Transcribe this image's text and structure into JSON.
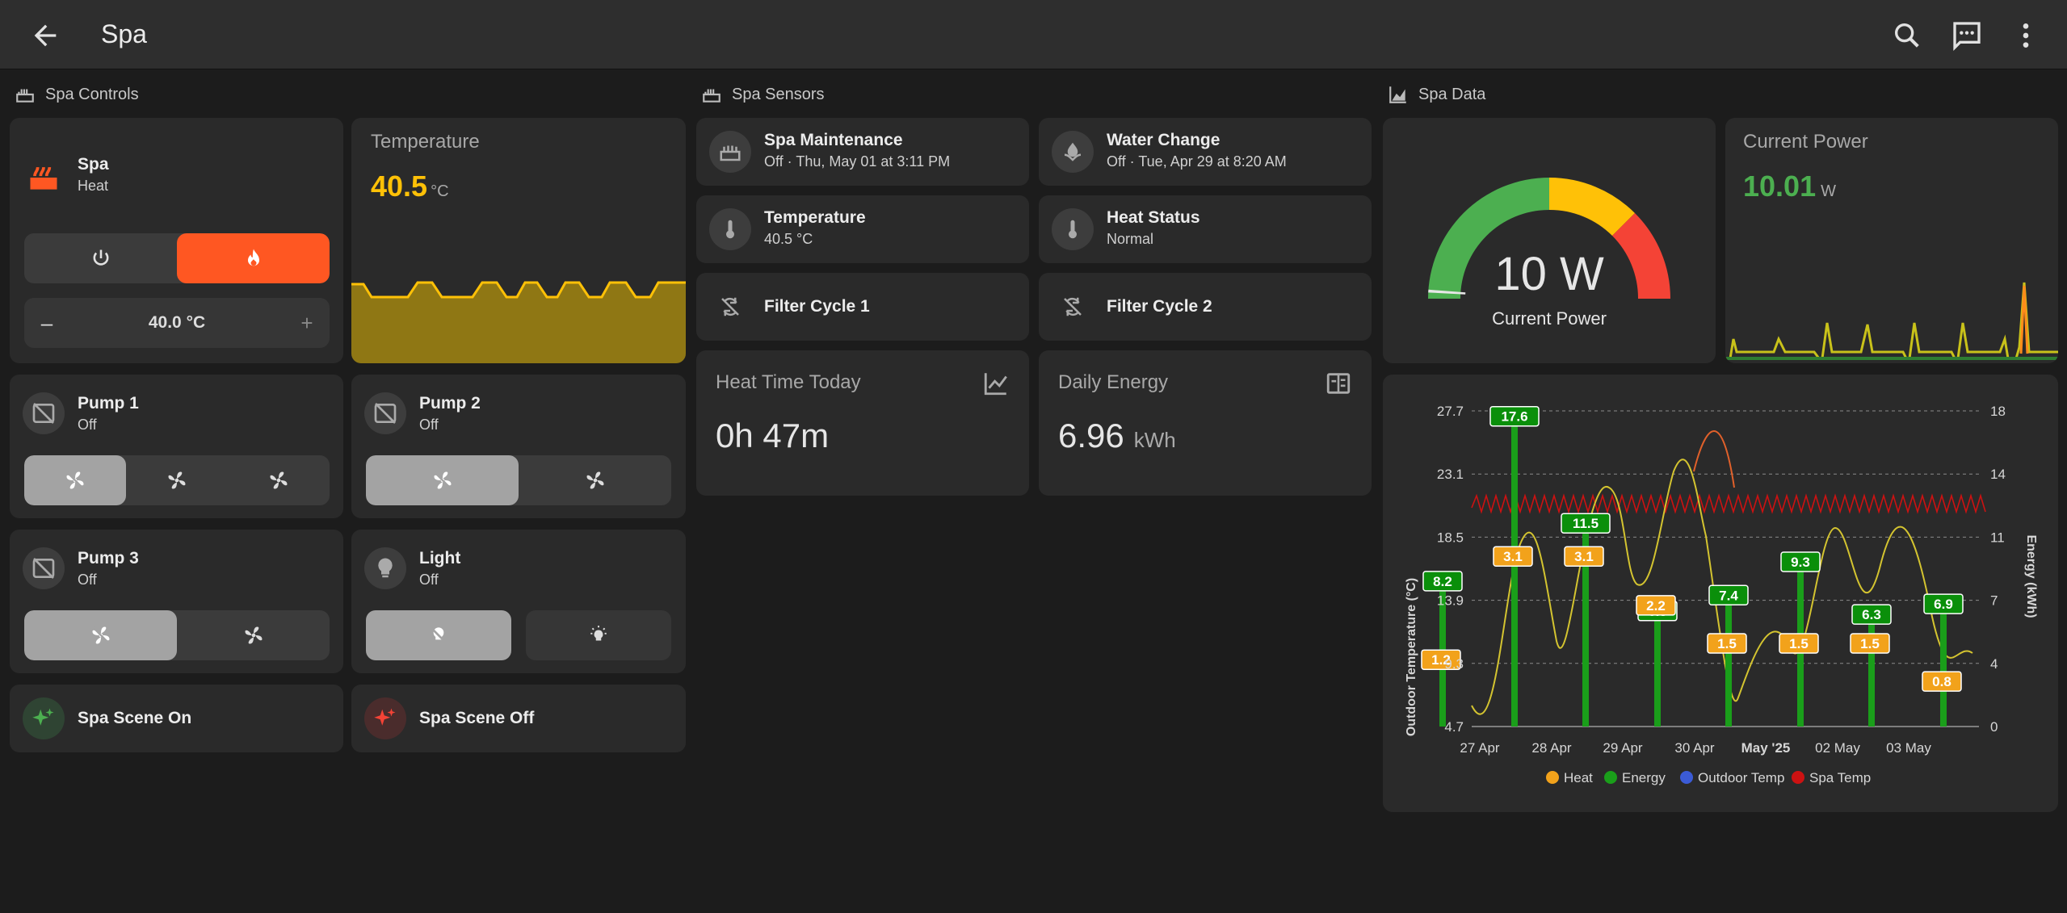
{
  "header": {
    "title": "Spa"
  },
  "sections": {
    "controls": "Spa Controls",
    "sensors": "Spa Sensors",
    "data": "Spa Data"
  },
  "colors": {
    "accent_orange": "#ff5722",
    "temp_yellow": "#ffc107",
    "gauge_green": "#4caf50",
    "gauge_yellow": "#ffc107",
    "gauge_red": "#f44336",
    "power_green": "#4caf50",
    "energy_green": "#1a9e1a",
    "heat_orange": "#f2a21b",
    "spatemp_red": "#cc1212",
    "outdoor_yellow": "#d4c430"
  },
  "spa": {
    "name": "Spa",
    "state": "Heat",
    "setpoint": "40.0 °C",
    "minus": "–",
    "plus": "+",
    "mode": "heat"
  },
  "temperature_tile": {
    "title": "Temperature",
    "value": "40.5",
    "unit": "°C"
  },
  "pumps": [
    {
      "name": "Pump 1",
      "state": "Off"
    },
    {
      "name": "Pump 2",
      "state": "Off"
    },
    {
      "name": "Pump 3",
      "state": "Off"
    }
  ],
  "light": {
    "name": "Light",
    "state": "Off"
  },
  "scenes": {
    "on": "Spa Scene On",
    "off": "Spa Scene Off"
  },
  "sensors": {
    "maintenance": {
      "name": "Spa Maintenance",
      "state": "Off · Thu, May 01 at 3:11 PM"
    },
    "water_change": {
      "name": "Water Change",
      "state": "Off · Tue, Apr 29 at 8:20 AM"
    },
    "temperature": {
      "name": "Temperature",
      "state": "40.5 °C"
    },
    "heat_status": {
      "name": "Heat Status",
      "state": "Normal"
    },
    "filter1": {
      "name": "Filter Cycle 1"
    },
    "filter2": {
      "name": "Filter Cycle 2"
    }
  },
  "heat_time": {
    "title": "Heat Time Today",
    "value": "0h 47m"
  },
  "daily_energy": {
    "title": "Daily Energy",
    "value": "6.96",
    "unit": "kWh"
  },
  "gauge": {
    "value": "10 W",
    "label": "Current Power",
    "fraction": 0.02
  },
  "current_power": {
    "title": "Current Power",
    "value": "10.01",
    "unit": "W"
  },
  "chart_data": {
    "type": "bar",
    "categories": [
      "27 Apr",
      "28 Apr",
      "29 Apr",
      "30 Apr",
      "May '25",
      "02 May",
      "03 May"
    ],
    "ylabel_left": "Outdoor Temperature (°C)",
    "ylabel_right": "Energy (kWh)",
    "yticks_left": [
      "4.7",
      "9.3",
      "13.9",
      "18.5",
      "23.1",
      "27.7"
    ],
    "yticks_right": [
      "0",
      "4",
      "7",
      "11",
      "14",
      "18"
    ],
    "ylim_left": [
      4.7,
      27.7
    ],
    "ylim_right": [
      0,
      18
    ],
    "grid": true,
    "legend": [
      "Heat",
      "Energy",
      "Outdoor Temp",
      "Spa Temp"
    ],
    "series": [
      {
        "name": "Energy",
        "type": "bar",
        "points": [
          [
            0,
            8.2
          ],
          [
            1,
            17.6
          ],
          [
            2,
            11.5
          ],
          [
            3,
            6.5
          ],
          [
            4,
            7.4
          ],
          [
            5,
            9.3
          ],
          [
            6,
            6.3
          ],
          [
            7,
            6.9
          ]
        ]
      },
      {
        "name": "Heat",
        "type": "bar",
        "points": [
          [
            0,
            1.2
          ],
          [
            1,
            3.1
          ],
          [
            2,
            3.1
          ],
          [
            3,
            2.2
          ],
          [
            4,
            1.5
          ],
          [
            5,
            1.5
          ],
          [
            6,
            1.5
          ],
          [
            7,
            0.8
          ]
        ]
      }
    ]
  }
}
